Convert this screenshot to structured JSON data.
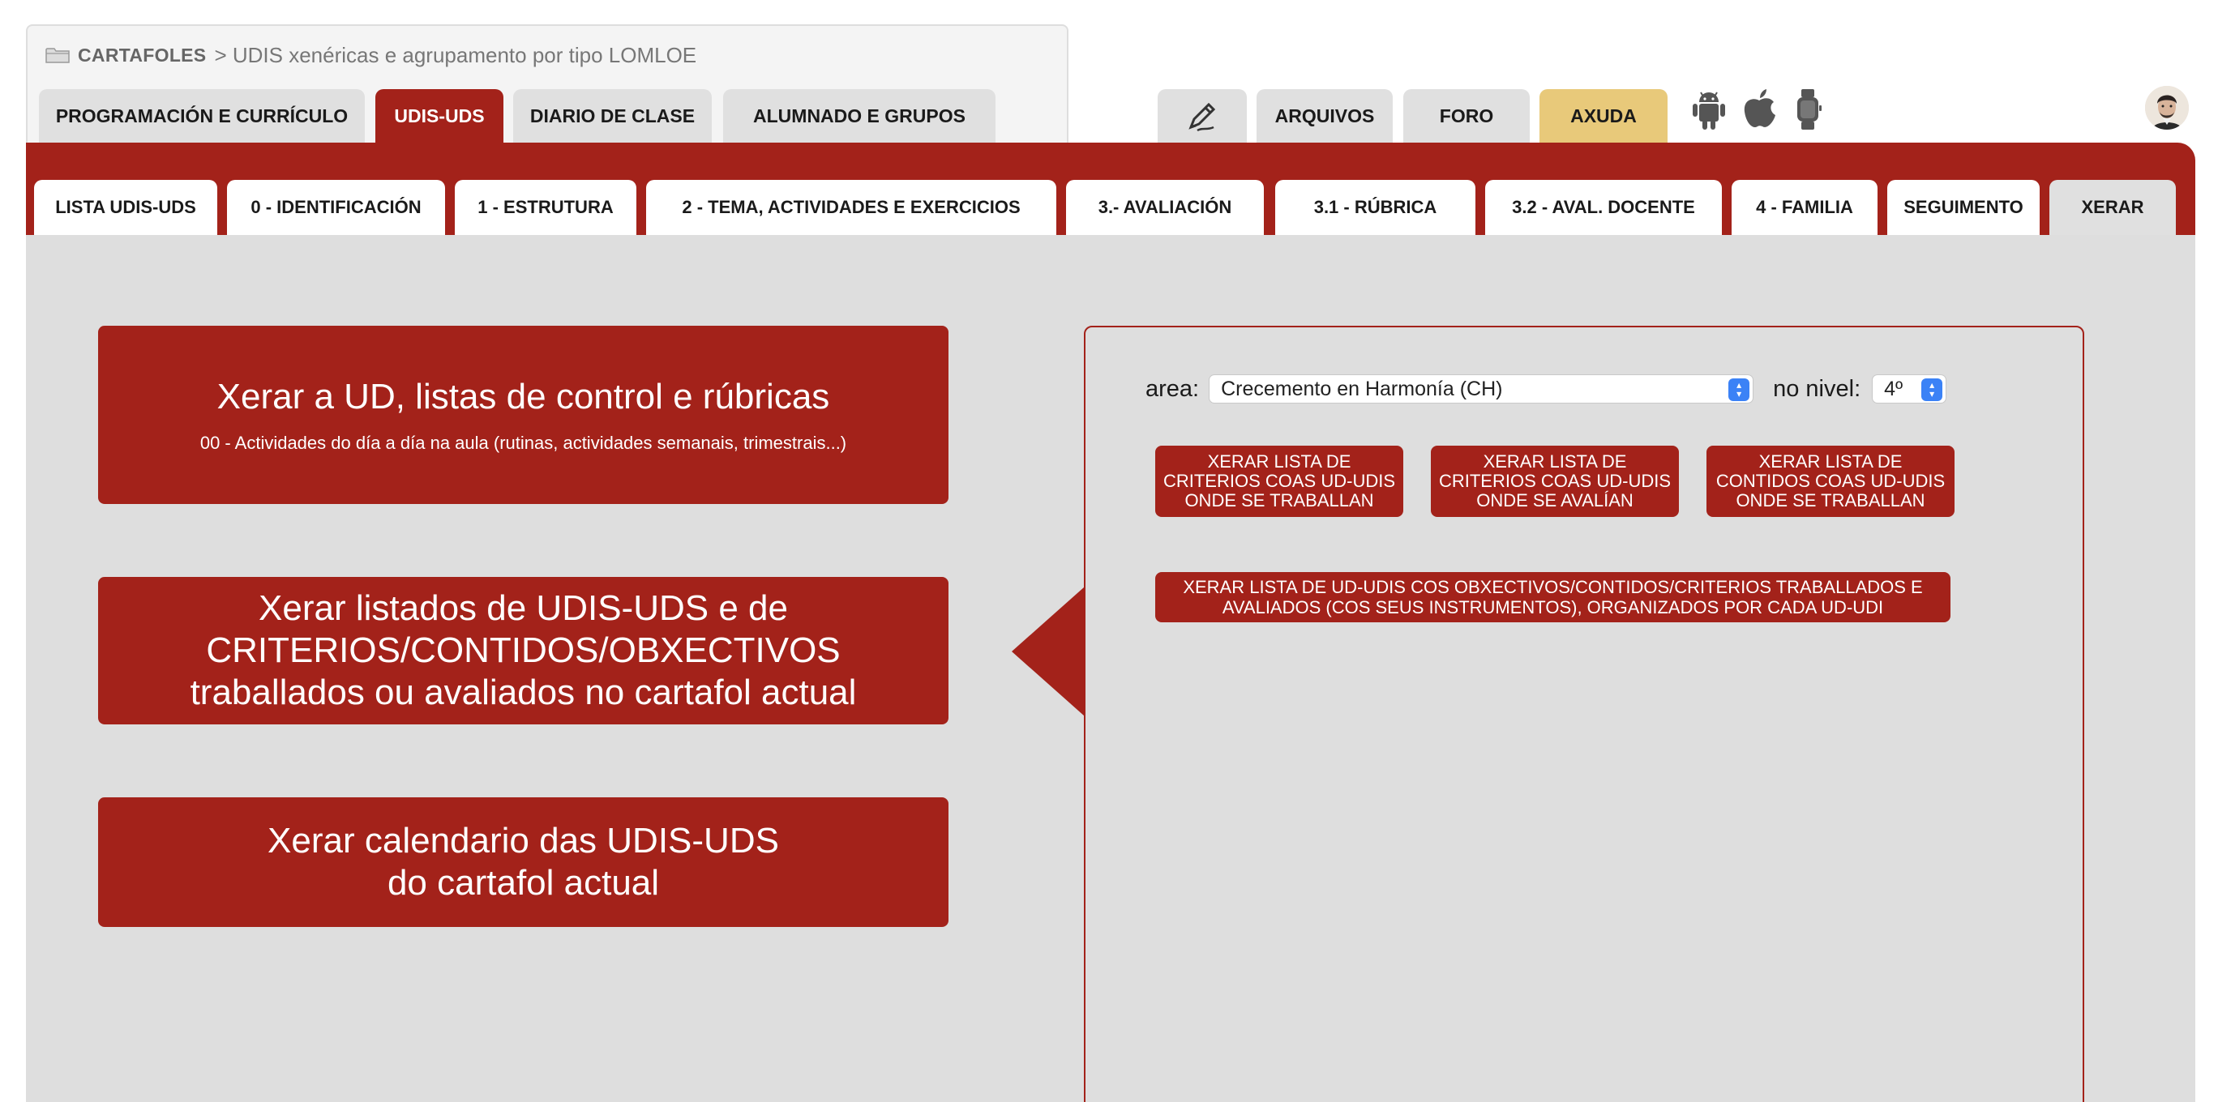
{
  "breadcrumb": {
    "home": "CARTAFOLES",
    "path": "> UDIS xenéricas e agrupamento por tipo LOMLOE"
  },
  "main_tabs": [
    {
      "label": "PROGRAMACIÓN E CURRÍCULO",
      "active": false
    },
    {
      "label": "UDIS-UDS",
      "active": true
    },
    {
      "label": "DIARIO DE CLASE",
      "active": false
    },
    {
      "label": "ALUMNADO E GRUPOS",
      "active": false
    }
  ],
  "right_tabs": [
    {
      "label": "",
      "icon": "pen-icon"
    },
    {
      "label": "ARQUIVOS"
    },
    {
      "label": "FORO"
    },
    {
      "label": "AXUDA"
    }
  ],
  "platform_icons": [
    "android-icon",
    "apple-icon",
    "watch-icon"
  ],
  "sub_tabs": [
    {
      "label": "LISTA UDIS-UDS"
    },
    {
      "label": "0 - IDENTIFICACIÓN"
    },
    {
      "label": "1 - ESTRUTURA"
    },
    {
      "label": "2 - TEMA, ACTIVIDADES E EXERCICIOS"
    },
    {
      "label": "3.- AVALIACIÓN"
    },
    {
      "label": "3.1 - RÚBRICA"
    },
    {
      "label": "3.2 - AVAL. DOCENTE"
    },
    {
      "label": "4 - FAMILIA"
    },
    {
      "label": "SEGUIMENTO"
    },
    {
      "label": "XERAR",
      "active": true
    }
  ],
  "cards": {
    "ud": {
      "title": "Xerar a UD, listas de control e rúbricas",
      "subtitle": "00 - Actividades do día a día na aula (rutinas, actividades semanais, trimestrais...)"
    },
    "listados": {
      "line1": "Xerar listados de UDIS-UDS e de",
      "line2": "CRITERIOS/CONTIDOS/OBXECTIVOS",
      "line3": "traballados ou avaliados no cartafol actual"
    },
    "calendario": {
      "line1": "Xerar calendario das UDIS-UDS",
      "line2": "do cartafol actual"
    }
  },
  "form": {
    "area_label": "area:",
    "area_value": "Crecemento en Harmonía (CH)",
    "level_label": "no nivel:",
    "level_value": "4º"
  },
  "buttons": {
    "criterios_traballan": "XERAR LISTA DE CRITERIOS COAS UD-UDIS ONDE SE TRABALLAN",
    "criterios_avalian": "XERAR LISTA DE CRITERIOS COAS UD-UDIS ONDE SE AVALÍAN",
    "contidos_traballan": "XERAR LISTA DE CONTIDOS COAS UD-UDIS ONDE SE TRABALLAN",
    "lista_ud": "XERAR LISTA DE UD-UDIS COS OBXECTIVOS/CONTIDOS/CRITERIOS TRABALLADOS E AVALIADOS (COS SEUS INSTRUMENTOS), ORGANIZADOS POR CADA UD-UDI"
  },
  "colors": {
    "brand_red": "#a3221a",
    "tab_grey": "#e0e0e0",
    "help_yellow": "#e8c97a",
    "content_grey": "#dedede"
  }
}
